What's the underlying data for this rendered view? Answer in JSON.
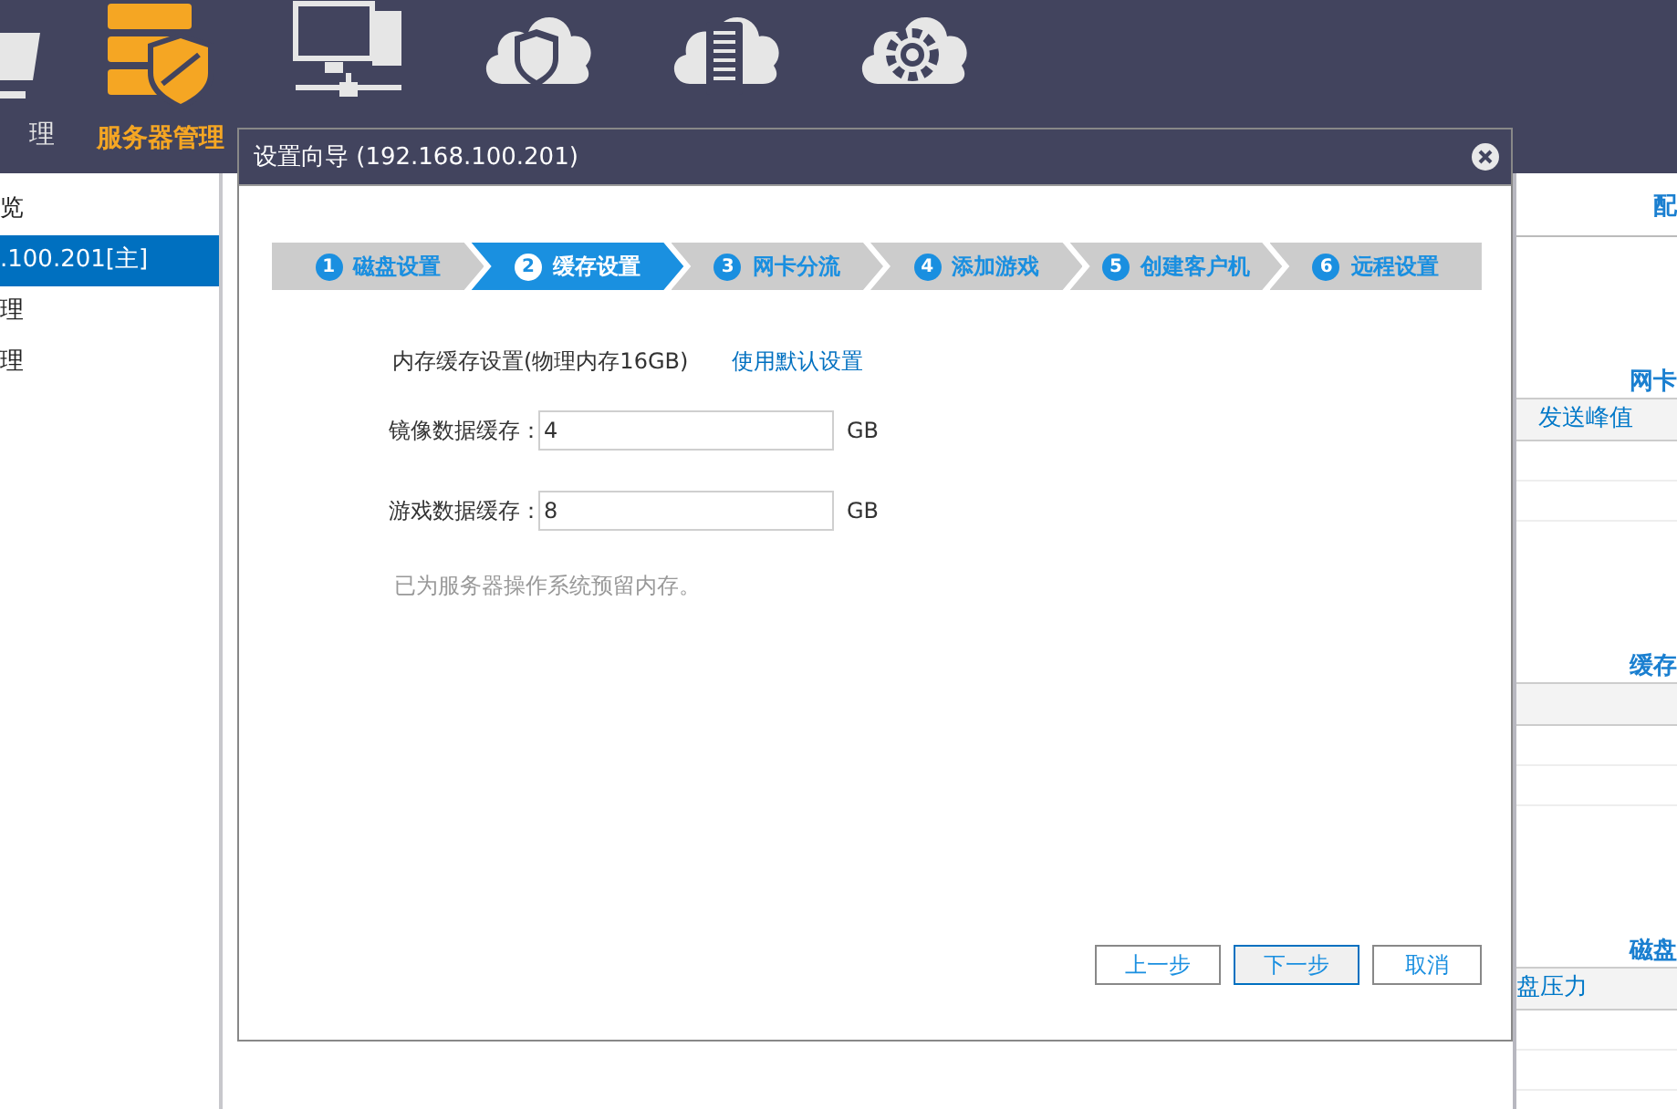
{
  "nav": {
    "items": [
      {
        "kind": "basket",
        "label": "理",
        "selected": false
      },
      {
        "kind": "server",
        "label": "服务器管理",
        "selected": true
      },
      {
        "kind": "computers",
        "selected": false
      },
      {
        "kind": "cloud-shield",
        "selected": false
      },
      {
        "kind": "cloud-doc",
        "selected": false
      },
      {
        "kind": "cloud-gear",
        "selected": false
      }
    ]
  },
  "sidebar": {
    "items": [
      {
        "label": "览",
        "selected": false
      },
      {
        "label": ".100.201[主]",
        "selected": true
      },
      {
        "label": "理",
        "selected": false
      },
      {
        "label": "理",
        "selected": false
      }
    ]
  },
  "right_panel": {
    "header": "配",
    "sections": [
      {
        "title": "网卡",
        "column": "发送峰值"
      },
      {
        "title": "缓存"
      },
      {
        "title": "磁盘",
        "column": "盘压力"
      }
    ]
  },
  "dialog": {
    "title": "设置向导 (192.168.100.201)",
    "steps": [
      {
        "number": "1",
        "label": "磁盘设置",
        "selected": false
      },
      {
        "number": "2",
        "label": "缓存设置",
        "selected": true
      },
      {
        "number": "3",
        "label": "网卡分流",
        "selected": false
      },
      {
        "number": "4",
        "label": "添加游戏",
        "selected": false
      },
      {
        "number": "5",
        "label": "创建客户机",
        "selected": false
      },
      {
        "number": "6",
        "label": "远程设置",
        "selected": false
      }
    ],
    "section_label": "内存缓存设置(物理内存16GB)",
    "link": "使用默认设置",
    "fields": [
      {
        "label": "镜像数据缓存：",
        "value": "4",
        "unit": "GB"
      },
      {
        "label": "游戏数据缓存：",
        "value": "8",
        "unit": "GB"
      }
    ],
    "note": "已为服务器操作系统预留内存。",
    "buttons": [
      {
        "label": "上一步",
        "default": false
      },
      {
        "label": "下一步",
        "default": true
      },
      {
        "label": "取消",
        "default": false
      }
    ]
  }
}
